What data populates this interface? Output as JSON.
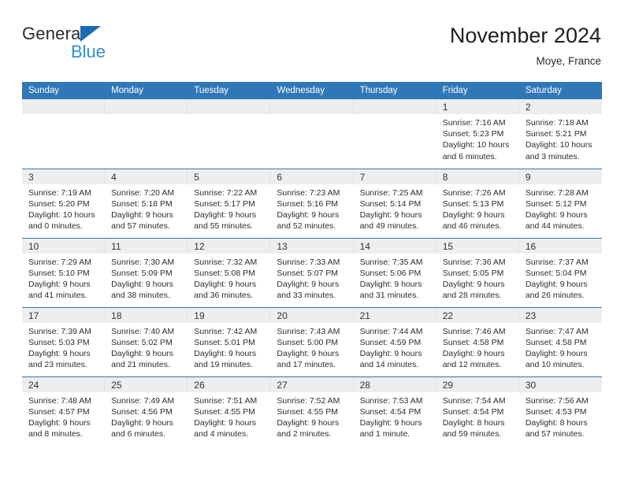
{
  "brand": {
    "word_one": "General",
    "word_two": "Blue",
    "triangle_color": "#1a6bb0",
    "blue_color": "#2b8fd4"
  },
  "header": {
    "title": "November 2024",
    "subtitle": "Moye, France"
  },
  "theme": {
    "header_blue": "#3077b8",
    "daynum_band": "#eeeeee",
    "page_background": "#ffffff"
  },
  "weekday_headers": [
    "Sunday",
    "Monday",
    "Tuesday",
    "Wednesday",
    "Thursday",
    "Friday",
    "Saturday"
  ],
  "weeks": [
    [
      {
        "day": "",
        "empty": true
      },
      {
        "day": "",
        "empty": true
      },
      {
        "day": "",
        "empty": true
      },
      {
        "day": "",
        "empty": true
      },
      {
        "day": "",
        "empty": true
      },
      {
        "day": "1",
        "sunrise": "Sunrise: 7:16 AM",
        "sunset": "Sunset: 5:23 PM",
        "daylight": "Daylight: 10 hours and 6 minutes."
      },
      {
        "day": "2",
        "sunrise": "Sunrise: 7:18 AM",
        "sunset": "Sunset: 5:21 PM",
        "daylight": "Daylight: 10 hours and 3 minutes."
      }
    ],
    [
      {
        "day": "3",
        "sunrise": "Sunrise: 7:19 AM",
        "sunset": "Sunset: 5:20 PM",
        "daylight": "Daylight: 10 hours and 0 minutes."
      },
      {
        "day": "4",
        "sunrise": "Sunrise: 7:20 AM",
        "sunset": "Sunset: 5:18 PM",
        "daylight": "Daylight: 9 hours and 57 minutes."
      },
      {
        "day": "5",
        "sunrise": "Sunrise: 7:22 AM",
        "sunset": "Sunset: 5:17 PM",
        "daylight": "Daylight: 9 hours and 55 minutes."
      },
      {
        "day": "6",
        "sunrise": "Sunrise: 7:23 AM",
        "sunset": "Sunset: 5:16 PM",
        "daylight": "Daylight: 9 hours and 52 minutes."
      },
      {
        "day": "7",
        "sunrise": "Sunrise: 7:25 AM",
        "sunset": "Sunset: 5:14 PM",
        "daylight": "Daylight: 9 hours and 49 minutes."
      },
      {
        "day": "8",
        "sunrise": "Sunrise: 7:26 AM",
        "sunset": "Sunset: 5:13 PM",
        "daylight": "Daylight: 9 hours and 46 minutes."
      },
      {
        "day": "9",
        "sunrise": "Sunrise: 7:28 AM",
        "sunset": "Sunset: 5:12 PM",
        "daylight": "Daylight: 9 hours and 44 minutes."
      }
    ],
    [
      {
        "day": "10",
        "sunrise": "Sunrise: 7:29 AM",
        "sunset": "Sunset: 5:10 PM",
        "daylight": "Daylight: 9 hours and 41 minutes."
      },
      {
        "day": "11",
        "sunrise": "Sunrise: 7:30 AM",
        "sunset": "Sunset: 5:09 PM",
        "daylight": "Daylight: 9 hours and 38 minutes."
      },
      {
        "day": "12",
        "sunrise": "Sunrise: 7:32 AM",
        "sunset": "Sunset: 5:08 PM",
        "daylight": "Daylight: 9 hours and 36 minutes."
      },
      {
        "day": "13",
        "sunrise": "Sunrise: 7:33 AM",
        "sunset": "Sunset: 5:07 PM",
        "daylight": "Daylight: 9 hours and 33 minutes."
      },
      {
        "day": "14",
        "sunrise": "Sunrise: 7:35 AM",
        "sunset": "Sunset: 5:06 PM",
        "daylight": "Daylight: 9 hours and 31 minutes."
      },
      {
        "day": "15",
        "sunrise": "Sunrise: 7:36 AM",
        "sunset": "Sunset: 5:05 PM",
        "daylight": "Daylight: 9 hours and 28 minutes."
      },
      {
        "day": "16",
        "sunrise": "Sunrise: 7:37 AM",
        "sunset": "Sunset: 5:04 PM",
        "daylight": "Daylight: 9 hours and 26 minutes."
      }
    ],
    [
      {
        "day": "17",
        "sunrise": "Sunrise: 7:39 AM",
        "sunset": "Sunset: 5:03 PM",
        "daylight": "Daylight: 9 hours and 23 minutes."
      },
      {
        "day": "18",
        "sunrise": "Sunrise: 7:40 AM",
        "sunset": "Sunset: 5:02 PM",
        "daylight": "Daylight: 9 hours and 21 minutes."
      },
      {
        "day": "19",
        "sunrise": "Sunrise: 7:42 AM",
        "sunset": "Sunset: 5:01 PM",
        "daylight": "Daylight: 9 hours and 19 minutes."
      },
      {
        "day": "20",
        "sunrise": "Sunrise: 7:43 AM",
        "sunset": "Sunset: 5:00 PM",
        "daylight": "Daylight: 9 hours and 17 minutes."
      },
      {
        "day": "21",
        "sunrise": "Sunrise: 7:44 AM",
        "sunset": "Sunset: 4:59 PM",
        "daylight": "Daylight: 9 hours and 14 minutes."
      },
      {
        "day": "22",
        "sunrise": "Sunrise: 7:46 AM",
        "sunset": "Sunset: 4:58 PM",
        "daylight": "Daylight: 9 hours and 12 minutes."
      },
      {
        "day": "23",
        "sunrise": "Sunrise: 7:47 AM",
        "sunset": "Sunset: 4:58 PM",
        "daylight": "Daylight: 9 hours and 10 minutes."
      }
    ],
    [
      {
        "day": "24",
        "sunrise": "Sunrise: 7:48 AM",
        "sunset": "Sunset: 4:57 PM",
        "daylight": "Daylight: 9 hours and 8 minutes."
      },
      {
        "day": "25",
        "sunrise": "Sunrise: 7:49 AM",
        "sunset": "Sunset: 4:56 PM",
        "daylight": "Daylight: 9 hours and 6 minutes."
      },
      {
        "day": "26",
        "sunrise": "Sunrise: 7:51 AM",
        "sunset": "Sunset: 4:55 PM",
        "daylight": "Daylight: 9 hours and 4 minutes."
      },
      {
        "day": "27",
        "sunrise": "Sunrise: 7:52 AM",
        "sunset": "Sunset: 4:55 PM",
        "daylight": "Daylight: 9 hours and 2 minutes."
      },
      {
        "day": "28",
        "sunrise": "Sunrise: 7:53 AM",
        "sunset": "Sunset: 4:54 PM",
        "daylight": "Daylight: 9 hours and 1 minute."
      },
      {
        "day": "29",
        "sunrise": "Sunrise: 7:54 AM",
        "sunset": "Sunset: 4:54 PM",
        "daylight": "Daylight: 8 hours and 59 minutes."
      },
      {
        "day": "30",
        "sunrise": "Sunrise: 7:56 AM",
        "sunset": "Sunset: 4:53 PM",
        "daylight": "Daylight: 8 hours and 57 minutes."
      }
    ]
  ]
}
